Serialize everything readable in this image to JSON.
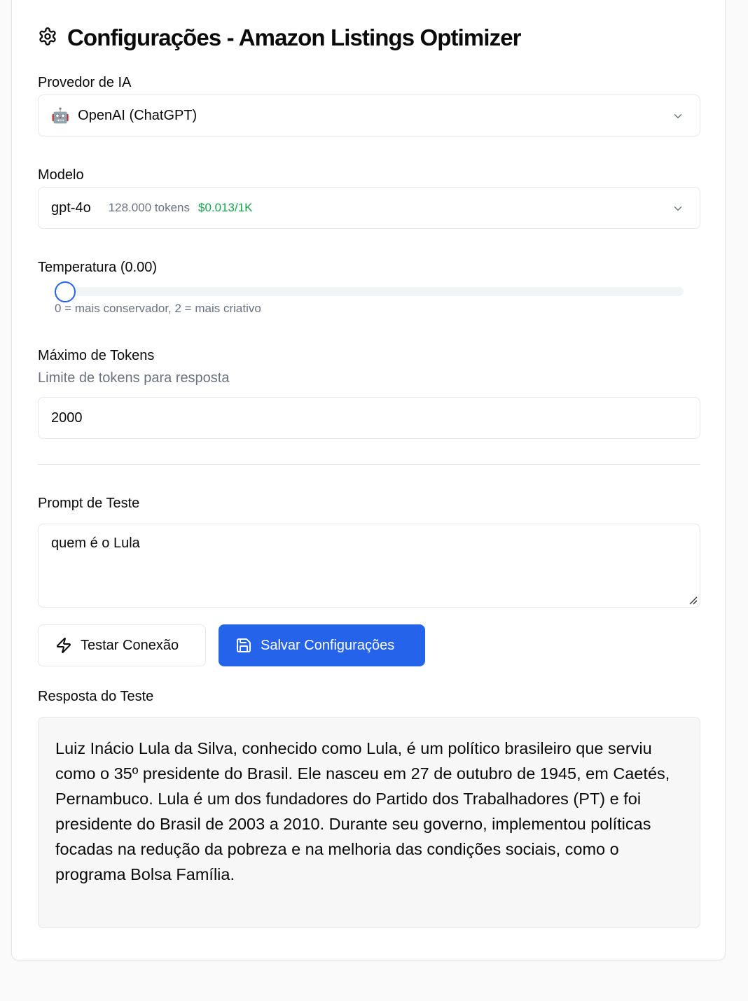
{
  "header": {
    "title": "Configurações - Amazon Listings Optimizer",
    "icon": "gear-icon"
  },
  "provider": {
    "label": "Provedor de IA",
    "icon": "🤖",
    "selected": "OpenAI (ChatGPT)"
  },
  "model": {
    "label": "Modelo",
    "selected_name": "gpt-4o",
    "tokens": "128.000 tokens",
    "price": "$0.013/1K",
    "price_color": "#16a34a"
  },
  "temperature": {
    "label": "Temperatura (0.00)",
    "value": 0,
    "min": 0,
    "max": 2,
    "hint": "0 = mais conservador, 2 = mais criativo"
  },
  "max_tokens": {
    "label": "Máximo de Tokens",
    "description": "Limite de tokens para resposta",
    "value": "2000"
  },
  "test_prompt": {
    "label": "Prompt de Teste",
    "value": "quem é o Lula"
  },
  "buttons": {
    "test_label": "Testar Conexão",
    "save_label": "Salvar Configurações",
    "primary_color": "#2563eb"
  },
  "response": {
    "label": "Resposta do Teste",
    "text": "Luiz Inácio Lula da Silva, conhecido como Lula, é um político brasileiro que serviu como o 35º presidente do Brasil. Ele nasceu em 27 de outubro de 1945, em Caetés, Pernambuco. Lula é um dos fundadores do Partido dos Trabalhadores (PT) e foi presidente do Brasil de 2003 a 2010. Durante seu governo, implementou políticas focadas na redução da pobreza e na melhoria das condições sociais, como o programa Bolsa Família."
  }
}
